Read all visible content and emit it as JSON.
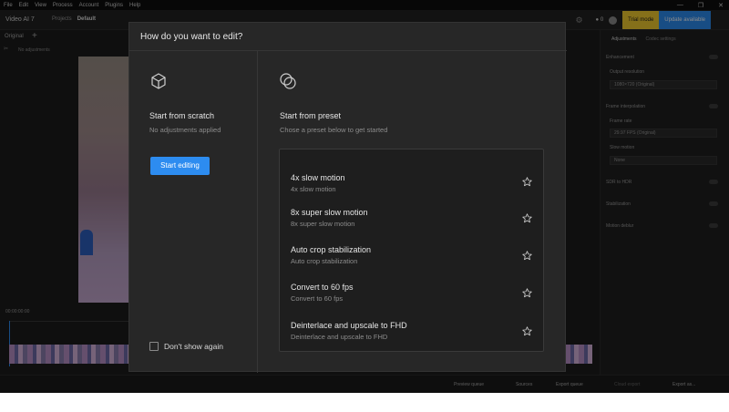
{
  "menu": [
    "File",
    "Edit",
    "View",
    "Process",
    "Account",
    "Plugins",
    "Help"
  ],
  "window_controls": [
    "—",
    "❐",
    "✕"
  ],
  "app": {
    "name": "Video AI 7",
    "breadcrumb_parent": "Projects",
    "breadcrumb_current": "Default",
    "credits": "0",
    "trial_label": "Trial mode",
    "update_label": "Update available"
  },
  "viewer": {
    "tab_original": "Original",
    "status": "No adjustments",
    "timecode": "00:00:00:00"
  },
  "right_panel": {
    "tab_active": "Adjustments",
    "tab_inactive": "Codec settings",
    "enhancement": "Enhancement",
    "output_resolution_label": "Output resolution",
    "output_resolution_value": "1080×720 (Original)",
    "frame_interp": "Frame interpolation",
    "frame_rate_label": "Frame rate",
    "frame_rate_value": "29.97 FPS (Original)",
    "slow_motion_label": "Slow motion",
    "slow_motion_value": "None",
    "sdr_to_hdr": "SDR to HDR",
    "stabilization": "Stabilization",
    "motion_deblur": "Motion deblur"
  },
  "bottombar": {
    "preview_queue": "Preview queue",
    "sources": "Sources",
    "export_queue": "Export queue",
    "cloud_export": "Cloud export",
    "export_as": "Export as..."
  },
  "modal": {
    "title": "How do you want to edit?",
    "scratch_title": "Start from scratch",
    "scratch_sub": "No adjustments applied",
    "start_button": "Start editing",
    "preset_title": "Start from preset",
    "preset_sub": "Chose a preset below to get started",
    "presets": [
      {
        "title": "4x slow motion",
        "sub": "4x slow motion"
      },
      {
        "title": "8x super slow motion",
        "sub": "8x super slow motion"
      },
      {
        "title": "Auto crop stabilization",
        "sub": "Auto crop stabilization"
      },
      {
        "title": "Convert to 60 fps",
        "sub": "Convert to 60 fps"
      },
      {
        "title": "Deinterlace and upscale to FHD",
        "sub": "Deinterlace and upscale to FHD"
      }
    ],
    "dont_show": "Don't show again"
  },
  "colors": {
    "accent": "#2d8cf0",
    "trial": "#f3cc30",
    "modal_bg": "#272727"
  }
}
